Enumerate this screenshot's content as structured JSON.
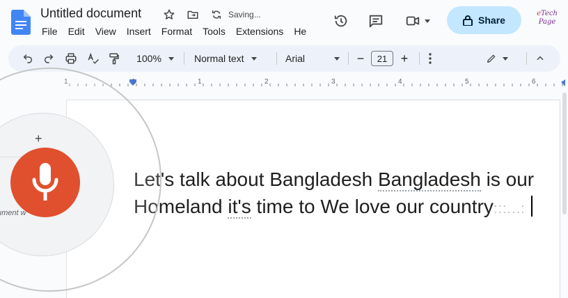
{
  "header": {
    "title": "Untitled document",
    "saving_status": "Saving...",
    "share_label": "Share",
    "icons": [
      "star-icon",
      "move-folder-icon",
      "sync-icon",
      "history-icon",
      "comment-icon",
      "meet-video-icon",
      "lock-icon"
    ]
  },
  "menu": [
    "File",
    "Edit",
    "View",
    "Insert",
    "Format",
    "Tools",
    "Extensions",
    "He"
  ],
  "watermark": {
    "line1": "e",
    "line1b": "Tech",
    "line2": "Page"
  },
  "toolbar": {
    "zoom": "100%",
    "style": "Normal text",
    "font": "Arial",
    "font_size": "21",
    "minus": "−",
    "plus": "+"
  },
  "ruler": {
    "labels": [
      "1",
      "1",
      "1",
      "2",
      "3",
      "4",
      "5",
      "6"
    ]
  },
  "document": {
    "line1_a": "Let's talk about Bangladesh ",
    "line1_b": "Bangladesh",
    "line1_c": " is our",
    "line2_a": "Homeland ",
    "line2_b": "it's",
    "line2_c": " time to We love our country",
    "trailing": ":::...:"
  },
  "voice": {
    "plus": "+",
    "label": "ument w"
  },
  "colors": {
    "share_bg": "#c2e7ff",
    "mic": "#e0502e",
    "toolbar_bg": "#edf2fa",
    "docs_blue": "#4285f4"
  }
}
